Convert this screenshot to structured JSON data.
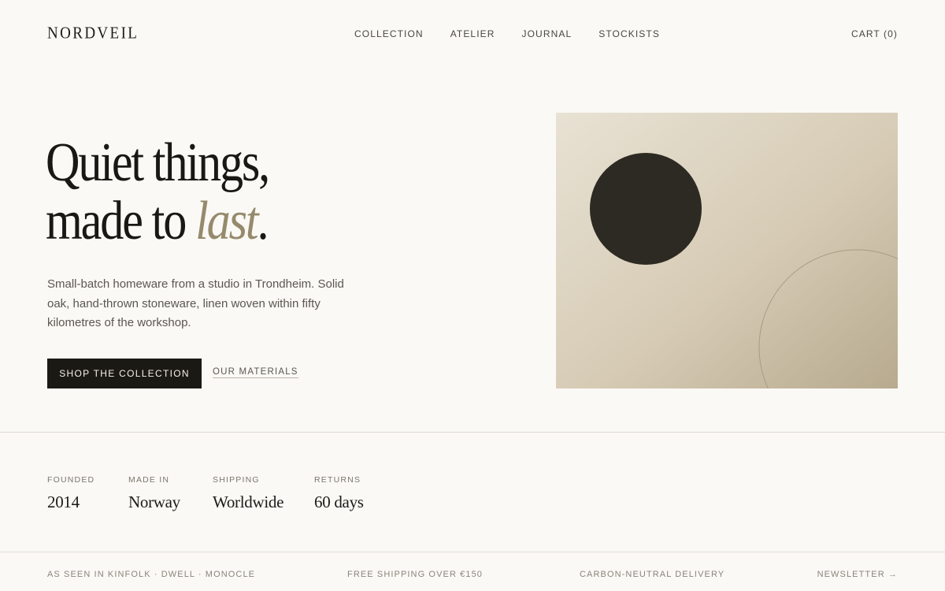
{
  "header": {
    "logo": "NORDVEIL",
    "nav": [
      "COLLECTION",
      "ATELIER",
      "JOURNAL",
      "STOCKISTS"
    ],
    "cart_label": "CART (0)"
  },
  "hero": {
    "title_line1": "Quiet things,",
    "title_line2_prefix": "made to ",
    "title_line2_accent": "last",
    "title_line2_suffix": ".",
    "description": "Small-batch homeware from a studio in Trondheim. Solid oak, hand-thrown stoneware, linen woven within fifty kilometres of the workshop.",
    "primary_cta": "SHOP THE COLLECTION",
    "secondary_cta": "OUR MATERIALS"
  },
  "stats": [
    {
      "label": "FOUNDED",
      "value": "2014"
    },
    {
      "label": "MADE IN",
      "value": "Norway"
    },
    {
      "label": "SHIPPING",
      "value": "Worldwide"
    },
    {
      "label": "RETURNS",
      "value": "60 days"
    }
  ],
  "strip": {
    "press": "AS SEEN IN KINFOLK · DWELL · MONOCLE",
    "shipping": "FREE SHIPPING OVER €150",
    "delivery": "CARBON-NEUTRAL DELIVERY",
    "newsletter": "NEWSLETTER →"
  },
  "colors": {
    "background": "#faf9f6",
    "ink": "#1a1813",
    "accent": "#968a6c",
    "button": "#1b1914",
    "image_light": "#e7e1d3",
    "image_dark": "#b7aa8f",
    "circle": "#2d2a23"
  }
}
